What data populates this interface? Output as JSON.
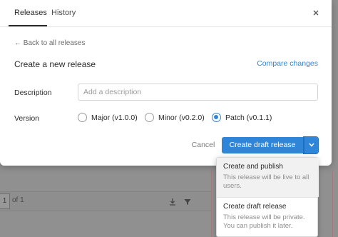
{
  "tabs": [
    {
      "label": "Releases"
    },
    {
      "label": "History"
    }
  ],
  "back_link": "Back to all releases",
  "page_title": "Create a new release",
  "compare_link": "Compare changes",
  "description": {
    "label": "Description",
    "placeholder": "Add a description",
    "value": ""
  },
  "version": {
    "label": "Version",
    "options": [
      {
        "label": "Major (v1.0.0)",
        "selected": false
      },
      {
        "label": "Minor (v0.2.0)",
        "selected": false
      },
      {
        "label": "Patch (v0.1.1)",
        "selected": true
      }
    ]
  },
  "actions": {
    "cancel_label": "Cancel",
    "primary_label": "Create draft release"
  },
  "dropdown": {
    "items": [
      {
        "title": "Create and publish",
        "desc": "This release will be live to all users."
      },
      {
        "title": "Create draft release",
        "desc": "This release will be private. You can publish it later."
      }
    ]
  },
  "background": {
    "page_box": "1",
    "page_of": "of 1"
  },
  "colors": {
    "accent": "#2f86d8",
    "overlay": "#8f8f8f"
  },
  "icons": [
    "close-icon",
    "arrow-left-icon",
    "chevron-down-icon",
    "download-icon",
    "filter-icon"
  ]
}
